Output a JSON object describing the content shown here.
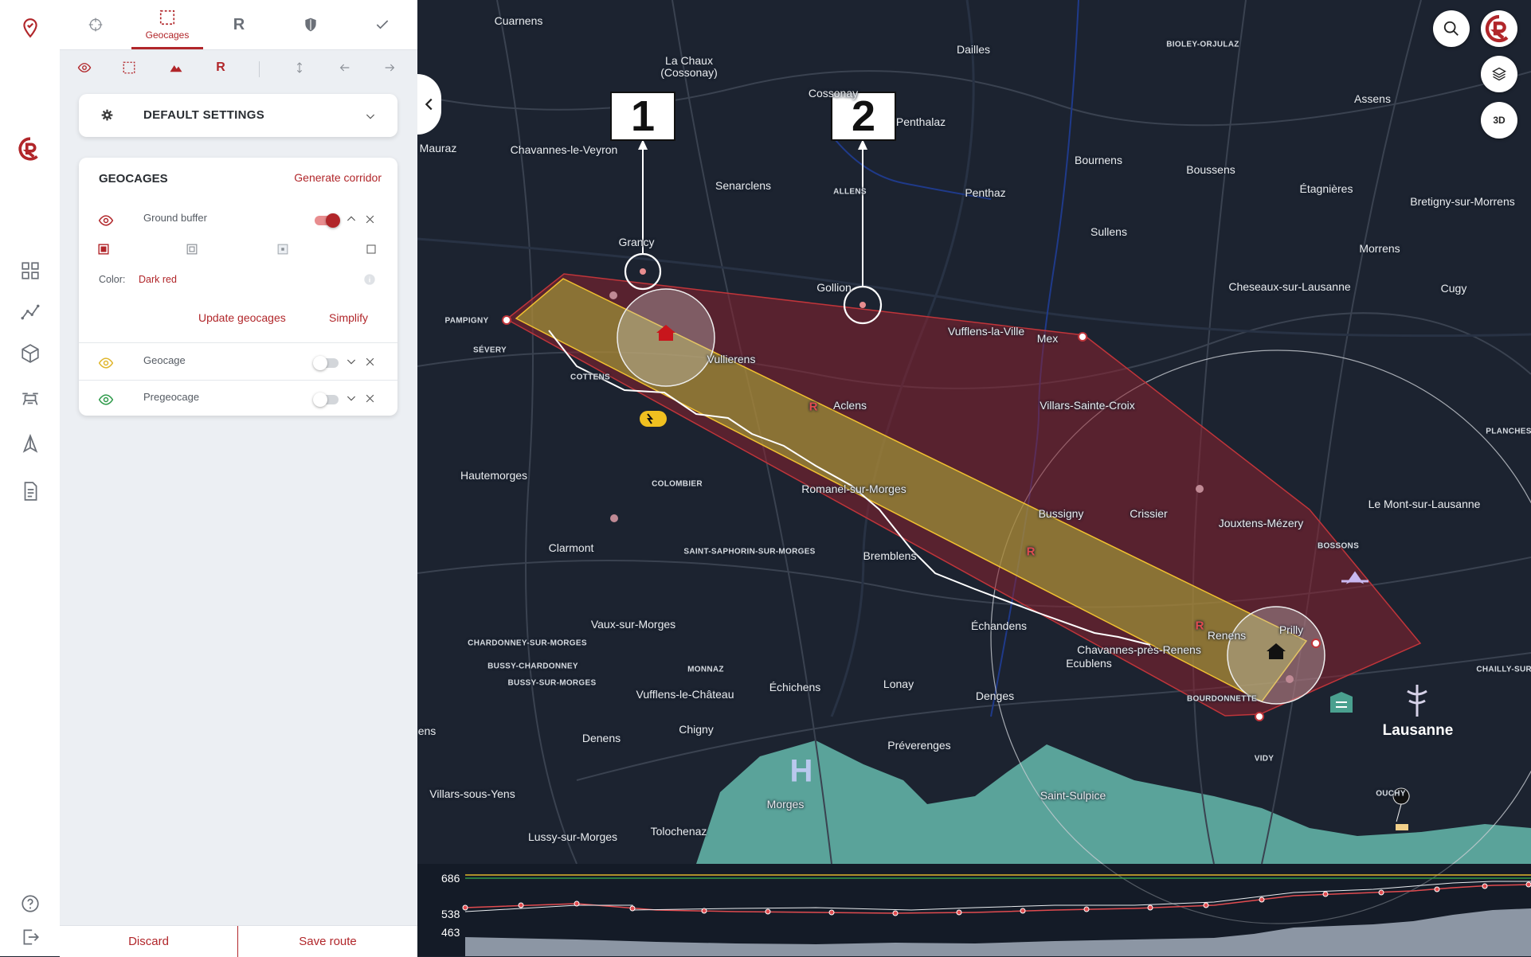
{
  "tabs": [
    {
      "name": "crosshair-icon",
      "label": ""
    },
    {
      "name": "geocages-icon",
      "label": "Geocages"
    },
    {
      "name": "route-r-icon",
      "label": "R"
    },
    {
      "name": "shield-icon",
      "label": ""
    },
    {
      "name": "check-icon",
      "label": ""
    }
  ],
  "toolbar": {
    "r_label": "R"
  },
  "settings": {
    "title": "DEFAULT SETTINGS"
  },
  "geocages": {
    "title": "GEOCAGES",
    "generate_label": "Generate corridor",
    "items": [
      {
        "label": "Ground buffer",
        "eye_color": "#b1262a",
        "enabled": true
      },
      {
        "label": "Geocage",
        "eye_color": "#e0b62c",
        "enabled": false
      },
      {
        "label": "Pregeocage",
        "eye_color": "#2e9a4a",
        "enabled": false
      }
    ],
    "color_label": "Color:",
    "color_value": "Dark red",
    "update_label": "Update geocages",
    "simplify_label": "Simplify"
  },
  "footer": {
    "discard": "Discard",
    "save": "Save route"
  },
  "map": {
    "view_3d": "3D",
    "callouts": [
      "1",
      "2"
    ],
    "route_marker": "R",
    "heliport_label": "H",
    "places": [
      "Cuarnens",
      "La Chaux",
      "(Cossonay)",
      "Cossonay",
      "Dailles",
      "BIOLEY-ORJULAZ",
      "Assens",
      "Mauraz",
      "Chavannes-le-Veyron",
      "Penthalaz",
      "Bournens",
      "Boussens",
      "Étagnières",
      "Bretigny-sur-Morrens",
      "Senarclens",
      "ALLENS",
      "Penthaz",
      "Sullens",
      "Morrens",
      "Grancy",
      "Gollion",
      "Cheseaux-sur-Lausanne",
      "Cugy",
      "PAMPIGNY",
      "Vufflens-la-Ville",
      "Mex",
      "SÉVERY",
      "Vullierens",
      "COTTENS",
      "Aclens",
      "Villars-Sainte-Croix",
      "PLANCHES",
      "Hautemorges",
      "COLOMBIER",
      "Romanel-sur-Morges",
      "Bussigny",
      "Crissier",
      "Le Mont-sur-Lausanne",
      "Jouxtens-Mézery",
      "Clarmont",
      "SAINT-SAPHORIN-SUR-MORGES",
      "Bremblens",
      "BOSSONS",
      "Vaux-sur-Morges",
      "Échandens",
      "Prilly",
      "CHARDONNEY-SUR-MORGES",
      "Chavannes-près-Renens",
      "Renens",
      "BUSSY-CHARDONNEY",
      "MONNAZ",
      "Ecublens",
      "CHAILLY-SUR-",
      "BUSSY-SUR-MORGES",
      "Vufflens-le-Château",
      "Échichens",
      "Lonay",
      "Denges",
      "BOURDONNETTE",
      "Lausanne",
      "Chigny",
      "Denens",
      "Préverenges",
      "VIDY",
      "ens",
      "Villars-sous-Yens",
      "Morges",
      "Saint-Sulpice",
      "OUCHY",
      "Lussy-sur-Morges",
      "Tolochenaz"
    ]
  },
  "profile": {
    "ticks": [
      "686",
      "538",
      "463"
    ]
  },
  "colors": {
    "accent": "#b1262a",
    "map_bg": "#1c2330",
    "lake": "#5aa39a",
    "corridor": "#b5b53a",
    "buffer": "#8a2230"
  }
}
